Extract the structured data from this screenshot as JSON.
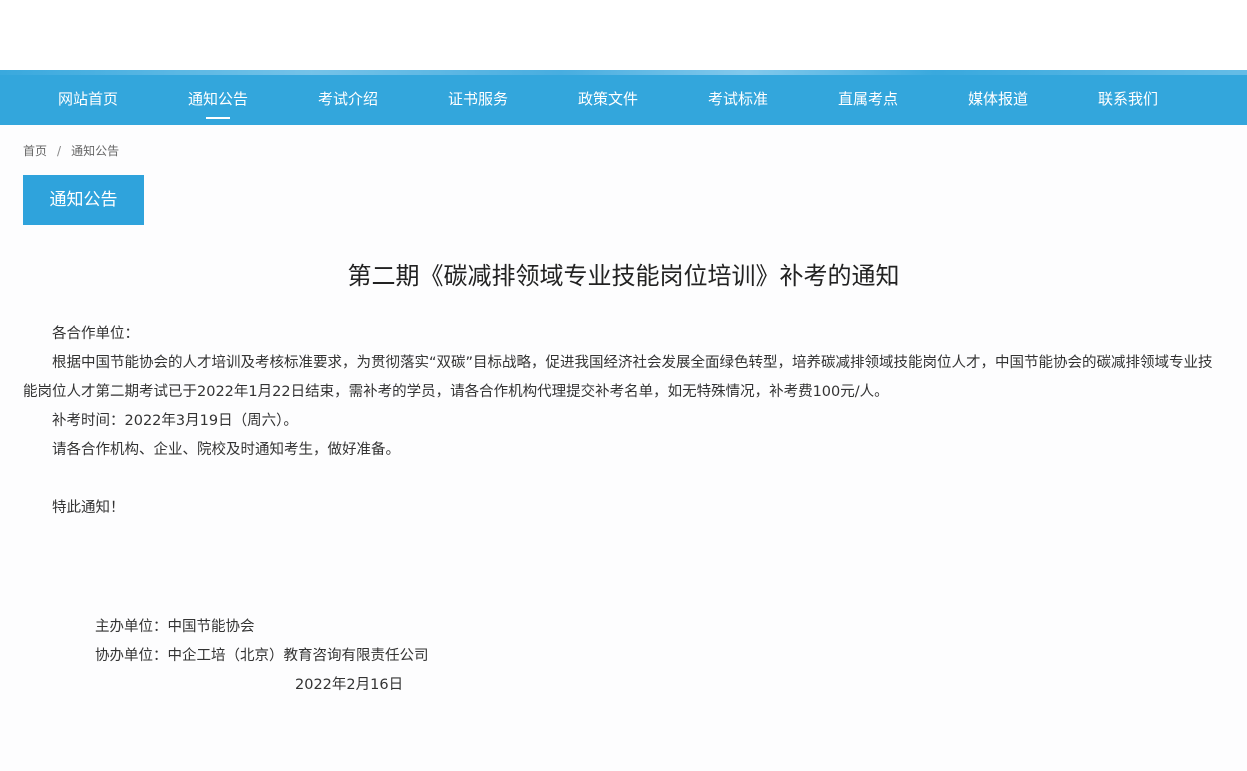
{
  "nav": {
    "items": [
      "网站首页",
      "通知公告",
      "考试介绍",
      "证书服务",
      "政策文件",
      "考试标准",
      "直属考点",
      "媒体报道",
      "联系我们"
    ],
    "active_index": 1
  },
  "breadcrumb": {
    "home": "首页",
    "separator": "/",
    "current": "通知公告"
  },
  "section_tab": "通知公告",
  "article": {
    "title": "第二期《碳减排领域专业技能岗位培训》补考的通知",
    "salutation": "各合作单位：",
    "paragraph1": "根据中国节能协会的人才培训及考核标准要求，为贯彻落实“双碳”目标战略，促进我国经济社会发展全面绿色转型，培养碳减排领域技能岗位人才，中国节能协会的碳减排领域专业技能岗位人才第二期考试已于2022年1月22日结束，需补考的学员，请各合作机构代理提交补考名单，如无特殊情况，补考费100元/人。",
    "paragraph2": "补考时间：2022年3月19日（周六）。",
    "paragraph3": "请各合作机构、企业、院校及时通知考生，做好准备。",
    "closing": "特此通知！",
    "organizer": "主办单位：中国节能协会",
    "co_organizer": "协办单位：中企工培（北京）教育咨询有限责任公司",
    "date": "2022年2月16日"
  },
  "colors": {
    "nav_bg": "#33a6dc",
    "tab_bg": "#2fa3dc",
    "text": "#333333"
  }
}
